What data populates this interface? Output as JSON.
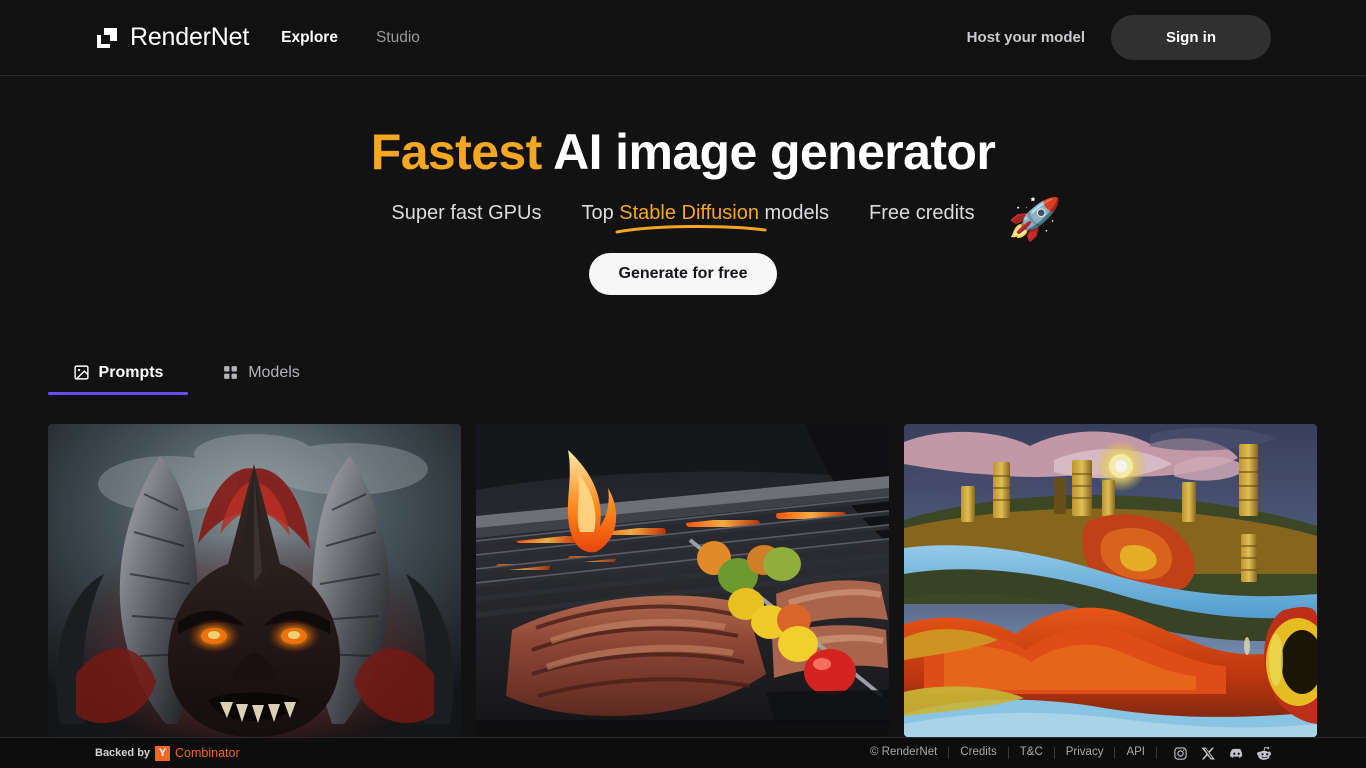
{
  "header": {
    "brand": {
      "name": "RenderNet",
      "logo_icon": "rendernet-squares-logo"
    },
    "nav": [
      {
        "label": "Explore",
        "active": true
      },
      {
        "label": "Studio",
        "active": false
      }
    ],
    "host_link": "Host your model",
    "signin_label": "Sign in"
  },
  "hero": {
    "title_accent": "Fastest",
    "title_rest": " AI image generator",
    "sub_1": "Super fast GPUs",
    "sub_2_pre": "Top ",
    "sub_2_accent": "Stable Diffusion",
    "sub_2_post": " models",
    "sub_3": "Free credits",
    "rocket_icon": "🚀",
    "cta_label": "Generate for free"
  },
  "tabs": [
    {
      "label": "Prompts",
      "icon": "image-icon",
      "active": true
    },
    {
      "label": "Models",
      "icon": "grid-icon",
      "active": false
    }
  ],
  "gallery": [
    {
      "alt": "Demon creature with horns and glowing orange eyes"
    },
    {
      "alt": "Barbecue grill with steaks and vegetable skewers over flames"
    },
    {
      "alt": "Surreal oil painting landscape with towers, river and sun"
    }
  ],
  "footer": {
    "backed_by": "Backed by",
    "yc_badge": "Y",
    "yc_name": "Combinator",
    "links": [
      "© RenderNet",
      "Credits",
      "T&C",
      "Privacy",
      "API"
    ],
    "socials": [
      {
        "name": "instagram-icon"
      },
      {
        "name": "x-twitter-icon"
      },
      {
        "name": "discord-icon"
      },
      {
        "name": "reddit-icon"
      }
    ]
  },
  "colors": {
    "accent_orange": "#F5A623",
    "tab_underline_purple": "#6B4BFF",
    "yc_orange": "#F26522",
    "background": "#121212",
    "header_bg": "#111111"
  }
}
